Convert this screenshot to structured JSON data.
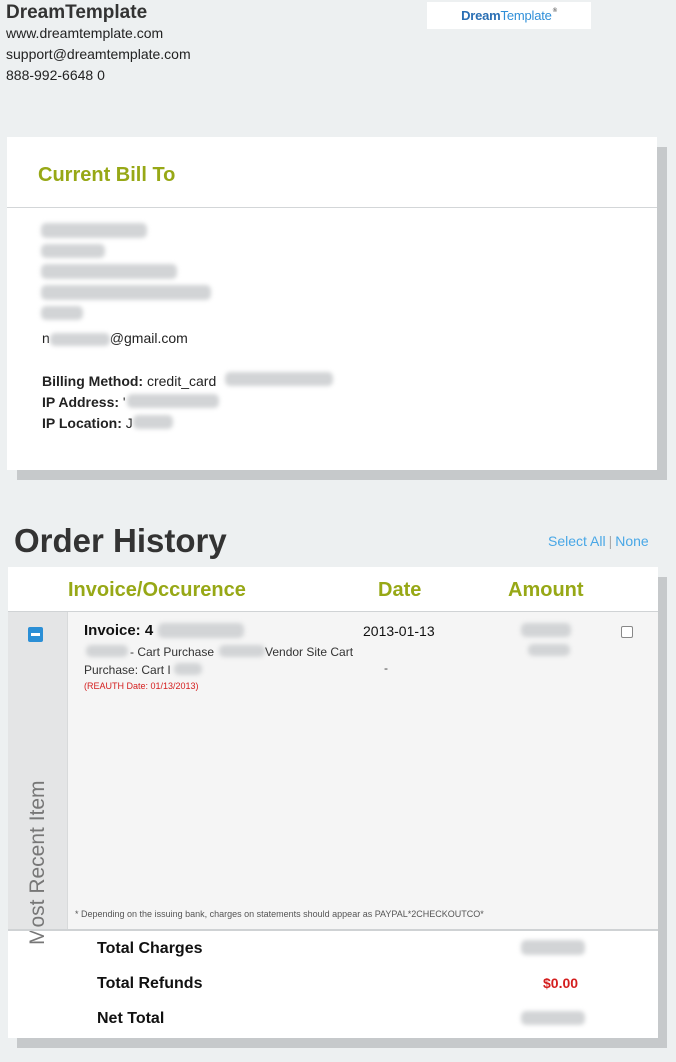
{
  "company": {
    "name": "DreamTemplate",
    "website": "www.dreamtemplate.com",
    "email": "support@dreamtemplate.com",
    "phone": "888-992-6648 0",
    "logo_text_bold": "Dream",
    "logo_text_light": "Template",
    "logo_mark": "®"
  },
  "bill_to": {
    "title": "Current Bill To",
    "email_prefix": "n",
    "email_domain": "@gmail.com",
    "billing_method_label": "Billing Method:",
    "billing_method_value": "credit_card",
    "ip_address_label": "IP Address:",
    "ip_address_value": "'",
    "ip_location_label": "IP Location:",
    "ip_location_value": "J"
  },
  "order_history": {
    "title": "Order History",
    "select_all": "Select All",
    "separator": "|",
    "none": "None",
    "columns": {
      "invoice": "Invoice/Occurence",
      "date": "Date",
      "amount": "Amount"
    },
    "group_label": "Most Recent Item",
    "invoice": {
      "label": "Invoice: 4",
      "line1_part1": "- Cart Purchase",
      "line1_part2": "Vendor Site Cart",
      "line2": "Purchase: Cart I",
      "reauth": "(REAUTH Date: 01/13/2013)",
      "date": "2013-01-13",
      "dash": "-"
    },
    "footnote": "* Depending on the issuing bank, charges on statements should appear as PAYPAL*2CHECKOUTCO*",
    "totals": {
      "total_charges_label": "Total Charges",
      "total_refunds_label": "Total Refunds",
      "total_refunds_value": "$0.00",
      "net_total_label": "Net Total"
    }
  },
  "colors": {
    "accent_green": "#97a816",
    "link_blue": "#49a7e6",
    "refund_red": "#d41e1e",
    "background": "#edf0f1"
  }
}
